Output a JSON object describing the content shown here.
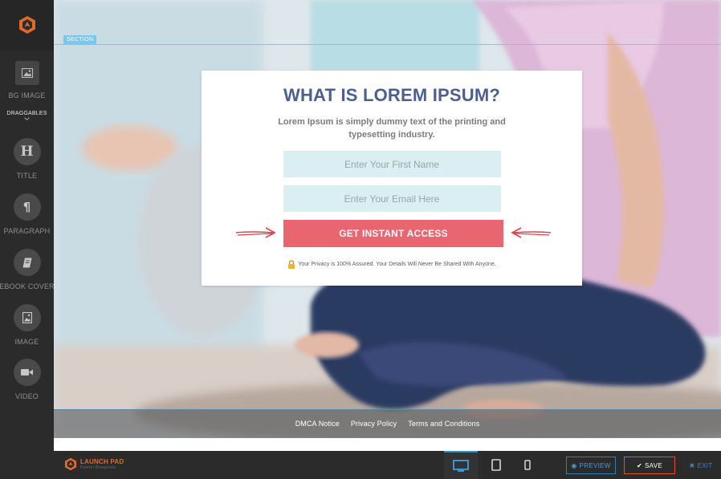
{
  "sidebar": {
    "draggables_label": "DRAGGABLES",
    "tools": [
      {
        "label": "BG IMAGE",
        "icon": "image-icon"
      },
      {
        "label": "TITLE",
        "icon": "heading-icon",
        "glyph": "H"
      },
      {
        "label": "PARAGRAPH",
        "icon": "paragraph-icon",
        "glyph": "¶"
      },
      {
        "label": "EBOOK COVER",
        "icon": "ebook-icon"
      },
      {
        "label": "IMAGE",
        "icon": "image-icon"
      },
      {
        "label": "VIDEO",
        "icon": "video-camera-icon"
      }
    ]
  },
  "canvas": {
    "section_tag": "SECTION",
    "optin": {
      "headline": "WHAT IS LOREM IPSUM?",
      "subtext": "Lorem Ipsum is simply dummy text of the printing and typesetting industry.",
      "first_name_placeholder": "Enter Your First Name",
      "email_placeholder": "Enter Your Email Here",
      "cta_label": "GET INSTANT ACCESS",
      "privacy_text": "Your Privacy is 100% Assured. Your Details Will Never Be Shared With Anyone."
    },
    "footer_links": [
      "DMCA Notice",
      "Privacy Policy",
      "Terms and Conditions"
    ]
  },
  "bottombar": {
    "brand_name": "LAUNCH PAD",
    "brand_sub": "Funnel Blueprints",
    "devices": [
      "desktop",
      "tablet",
      "mobile"
    ],
    "preview_label": "PREVIEW",
    "save_label": "SAVE",
    "exit_label": "EXIT"
  },
  "colors": {
    "accent_blue": "#79c6ee",
    "headline": "#4d5f8f",
    "cta": "#e96570",
    "field_bg": "#d9eff2",
    "brand_orange": "#e06a2c",
    "sidebar_bg": "#2b2b2b"
  }
}
